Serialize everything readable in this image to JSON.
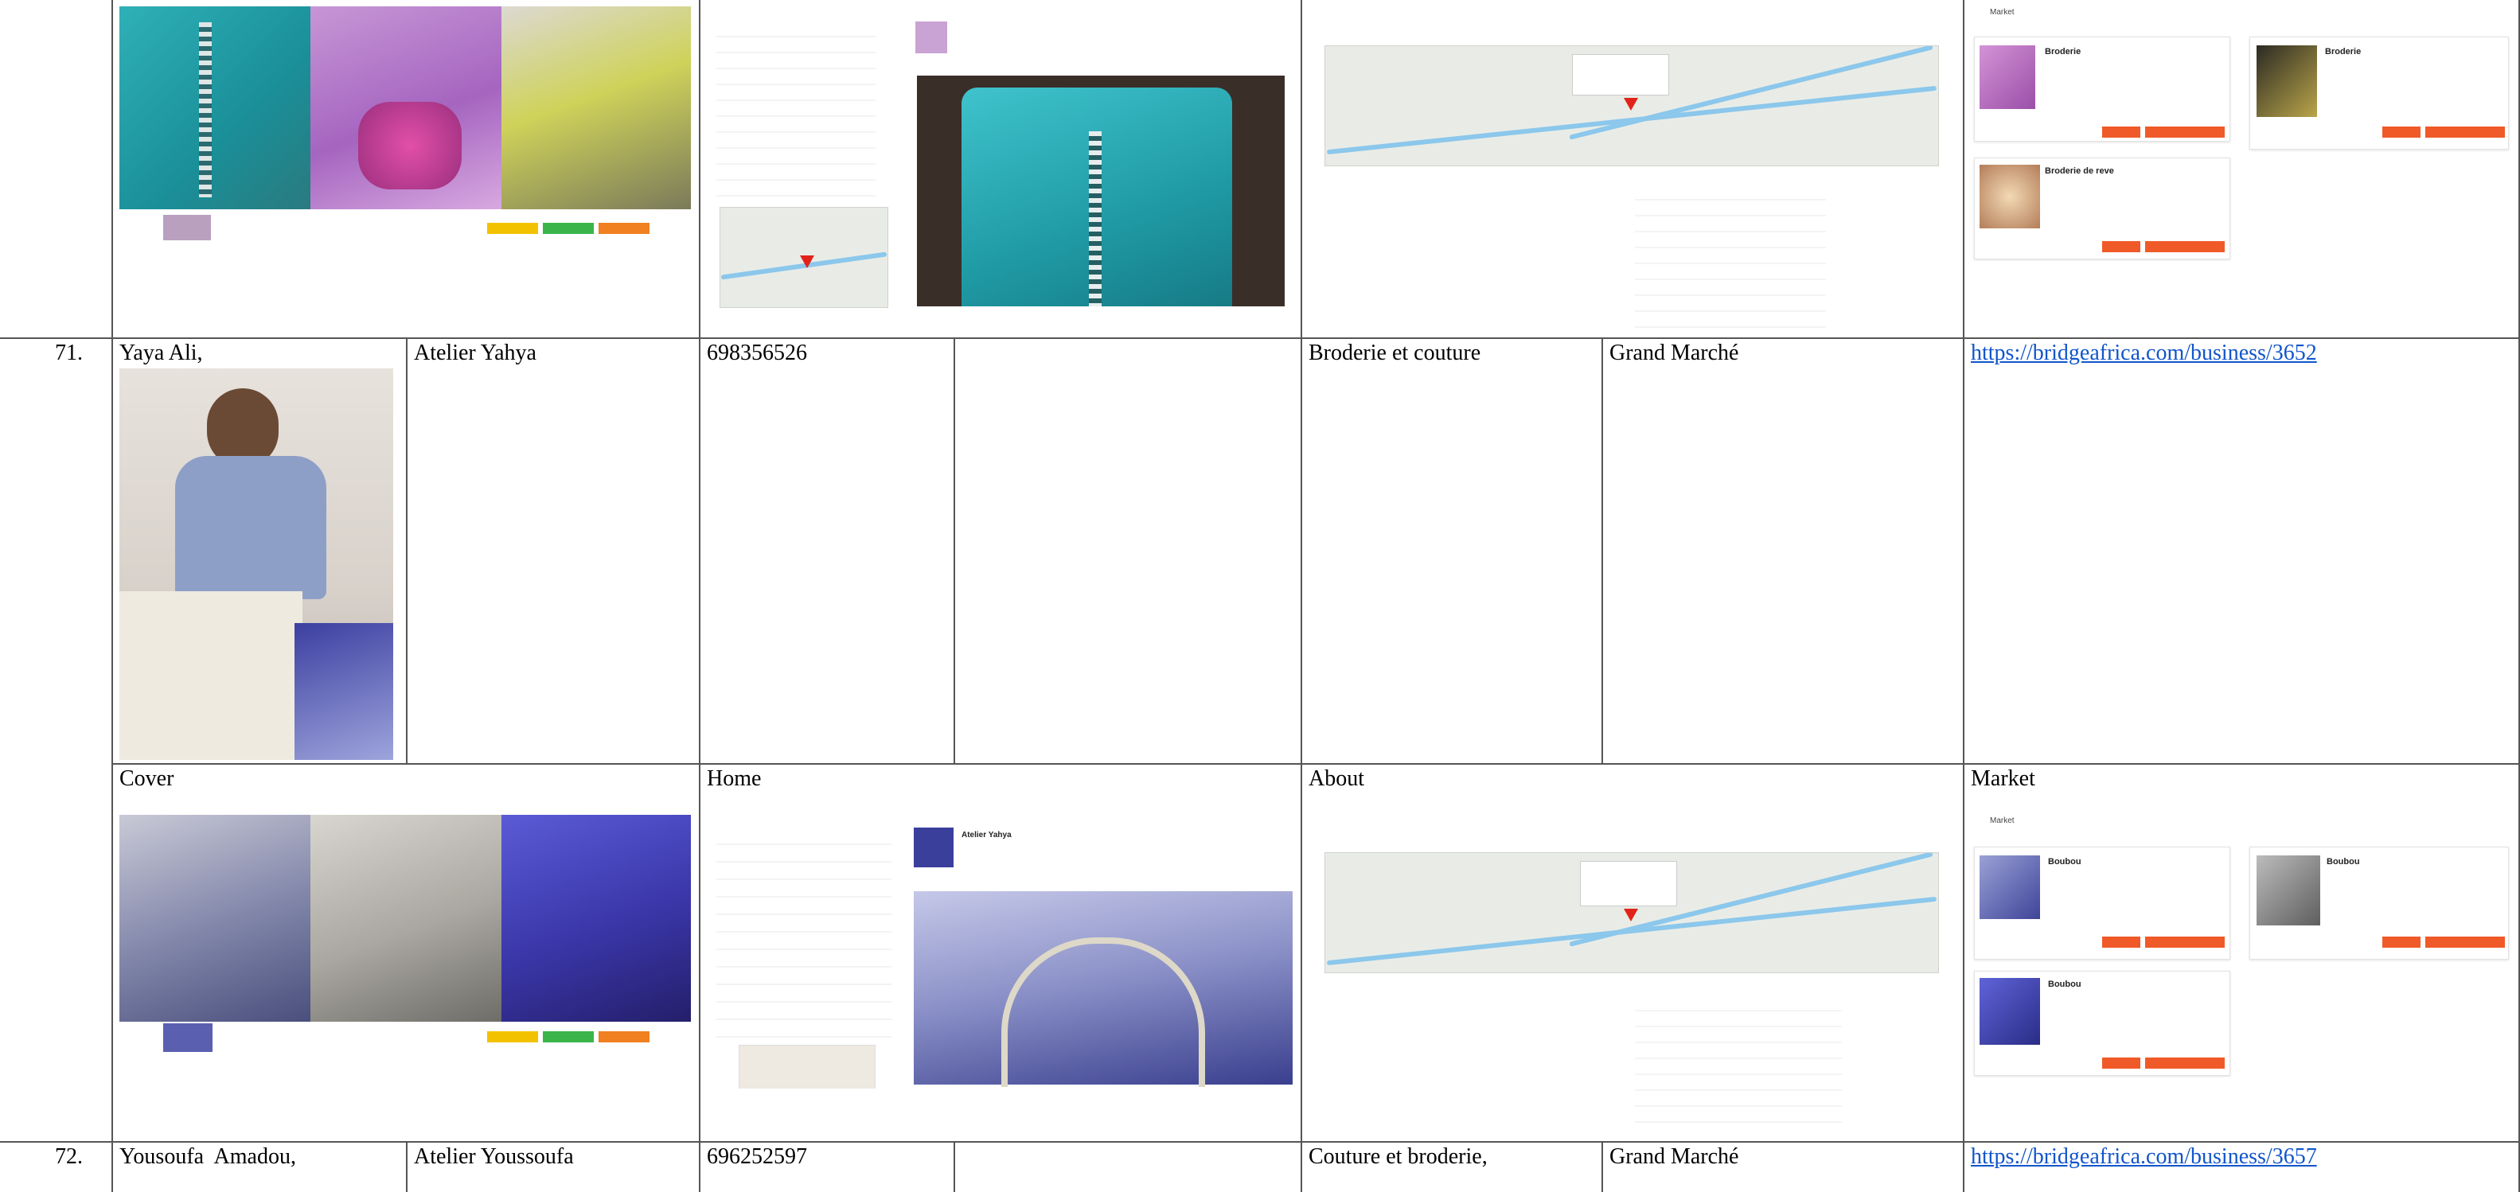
{
  "rows": [
    {
      "number": "71.",
      "name": "Yaya Ali,",
      "business": "Atelier Yahya",
      "phone": "698356526",
      "category": "Broderie et couture",
      "location": "Grand Marché",
      "url": "https://bridgeafrica.com/business/3652"
    },
    {
      "number": "72.",
      "name": "Yousoufa  Amadou,",
      "business": "Atelier Youssoufa",
      "phone": "696252597",
      "category": "Couture et broderie,",
      "location": "Grand Marché",
      "url": "https://bridgeafrica.com/business/3657"
    }
  ],
  "section_labels": {
    "cover": "Cover",
    "home": "Home",
    "about": "About",
    "market": "Market"
  },
  "market_top": {
    "header": "Market",
    "products": [
      "Broderie",
      "Broderie",
      "Broderie de reve"
    ]
  },
  "market_yahya": {
    "header": "Market",
    "products": [
      "Boubou",
      "Boubou",
      "Boubou"
    ]
  },
  "home_yahya": {
    "business_title": "Atelier Yahya"
  },
  "colors": {
    "link": "#1155cc",
    "market_orange": "#f05a28",
    "button_yellow": "#f2c200",
    "button_green": "#3bb54a",
    "button_orange": "#f08020",
    "map_water": "#8cc7ec"
  }
}
